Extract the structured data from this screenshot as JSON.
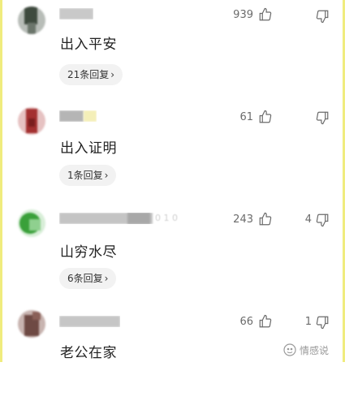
{
  "comments": [
    {
      "text": "出入平安",
      "name_tail": "",
      "likes": "939",
      "dislikes": "",
      "replies": "21条回复",
      "avatar_colors": [
        "#3e4a3e",
        "#b8bdb8",
        "#6b756b"
      ]
    },
    {
      "text": "出入证明",
      "name_tail": "",
      "likes": "61",
      "dislikes": "",
      "replies": "1条回复",
      "avatar_colors": [
        "#a33030",
        "#e6c2c2",
        "#7a1e1e"
      ]
    },
    {
      "text": "山穷水尽",
      "name_tail": "0 1 0",
      "likes": "243",
      "dislikes": "4",
      "replies": "6条回复",
      "avatar_colors": [
        "#3aa03a",
        "#8fd08f",
        "#d8eed8"
      ]
    },
    {
      "text": "老公在家",
      "name_tail": "",
      "likes": "66",
      "dislikes": "1",
      "replies": "",
      "avatar_colors": [
        "#6e4a44",
        "#c8b4b0",
        "#8a6058"
      ]
    }
  ],
  "colors": {
    "frame": "#f0ec7e",
    "text": "#222222",
    "count": "#6b6b6b",
    "pill_bg": "#f2f2f2"
  },
  "icons": {
    "like": "thumbs-up-icon",
    "dislike": "thumbs-down-icon",
    "reply_arrow": "chevron-right-icon",
    "watermark": "brand-logo-icon"
  },
  "watermark": {
    "text": "情感说"
  }
}
